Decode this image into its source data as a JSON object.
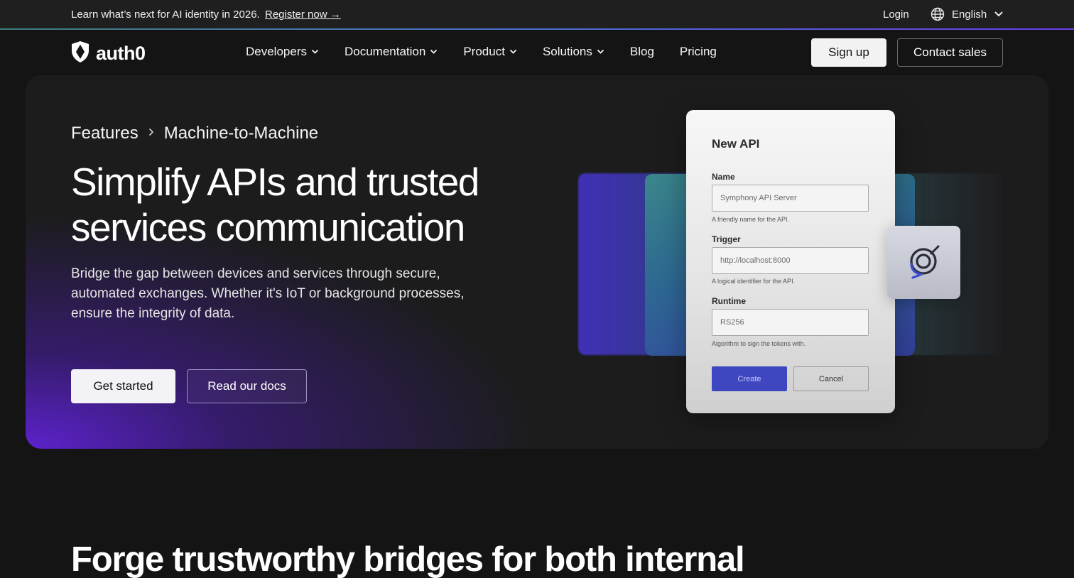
{
  "announcement": {
    "text": "Learn what’s next for AI identity in 2026.",
    "link_label": "Register now →",
    "login_label": "Login",
    "language_label": "English"
  },
  "nav": {
    "logo_text": "auth0",
    "items": [
      {
        "label": "Developers",
        "has_dropdown": true
      },
      {
        "label": "Documentation",
        "has_dropdown": true
      },
      {
        "label": "Product",
        "has_dropdown": true
      },
      {
        "label": "Solutions",
        "has_dropdown": true
      },
      {
        "label": "Blog",
        "has_dropdown": false
      },
      {
        "label": "Pricing",
        "has_dropdown": false
      }
    ],
    "signup_label": "Sign up",
    "contact_label": "Contact sales"
  },
  "hero": {
    "breadcrumb": [
      "Features",
      "Machine-to-Machine"
    ],
    "title": "Simplify APIs and trusted services communication",
    "description": "Bridge the gap between devices and services through secure, automated exchanges. Whether it's IoT or background processes, ensure the integrity of data.",
    "primary_cta": "Get started",
    "secondary_cta": "Read our docs"
  },
  "api_form": {
    "title": "New API",
    "fields": [
      {
        "label": "Name",
        "value": "Symphony API Server",
        "hint": "A friendly name for the API."
      },
      {
        "label": "Trigger",
        "value": "http://localhost:8000",
        "hint": "A logical identifier for the API."
      },
      {
        "label": "Runtime",
        "value": "RS256",
        "hint": "Algorithm to sign the tokens with."
      }
    ],
    "create_label": "Create",
    "cancel_label": "Cancel"
  },
  "section": {
    "title": "Forge trustworthy bridges for both internal"
  },
  "colors": {
    "page_bg": "#141414",
    "announce_bg": "#1f1f1f",
    "accent_purple": "#6022d6",
    "create_button": "#3f47c0"
  }
}
